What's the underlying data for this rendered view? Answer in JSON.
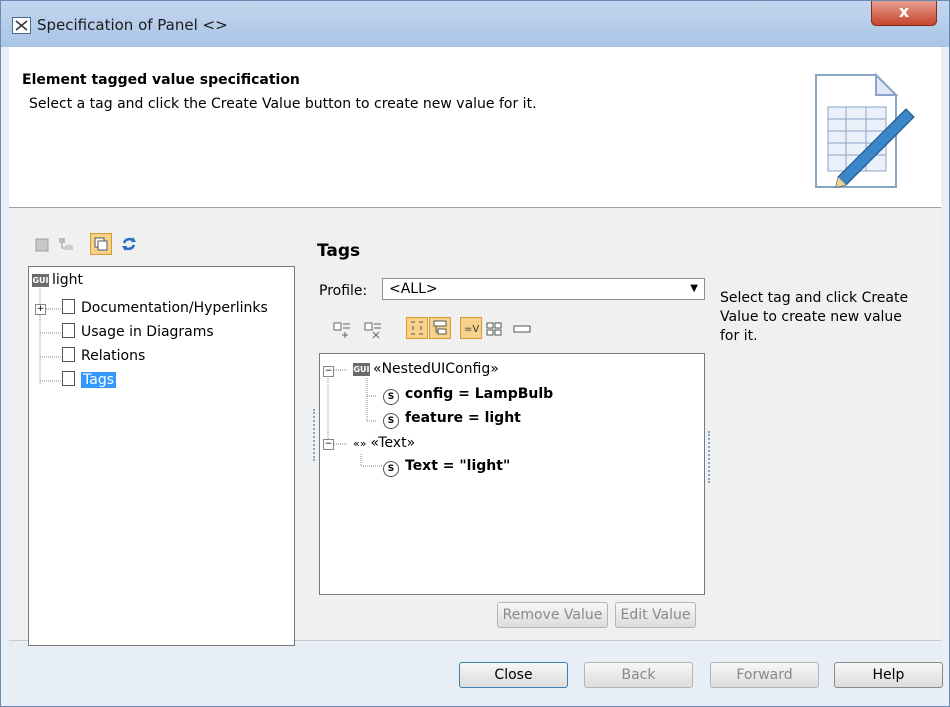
{
  "window": {
    "title": "Specification of Panel <>",
    "close_label": "x"
  },
  "header": {
    "title": "Element tagged value specification",
    "subtitle": "Select a tag and click the Create Value button to create new value for it."
  },
  "tree": {
    "root": "light",
    "items": [
      "Documentation/Hyperlinks",
      "Usage in Diagrams",
      "Relations",
      "Tags"
    ],
    "root_icon_label": "GUI"
  },
  "tags": {
    "title": "Tags",
    "profile_label": "Profile:",
    "profile_value": "<ALL>",
    "hint": "Select tag and click Create Value to create new value for it.",
    "groups": [
      {
        "name": "«NestedUIConfig»",
        "icon_label": "GUI",
        "values": [
          "config = LampBulb",
          "feature = light"
        ]
      },
      {
        "name": "«Text»",
        "icon_label": "«»",
        "values": [
          "Text = \"light\""
        ]
      }
    ],
    "remove_label": "Remove Value",
    "edit_label": "Edit Value"
  },
  "footer": {
    "close": "Close",
    "back": "Back",
    "forward": "Forward",
    "help": "Help"
  },
  "colors": {
    "title_bar": "#b7cde9",
    "selection": "#3399ff",
    "toggle_on": "#f7d28b"
  }
}
